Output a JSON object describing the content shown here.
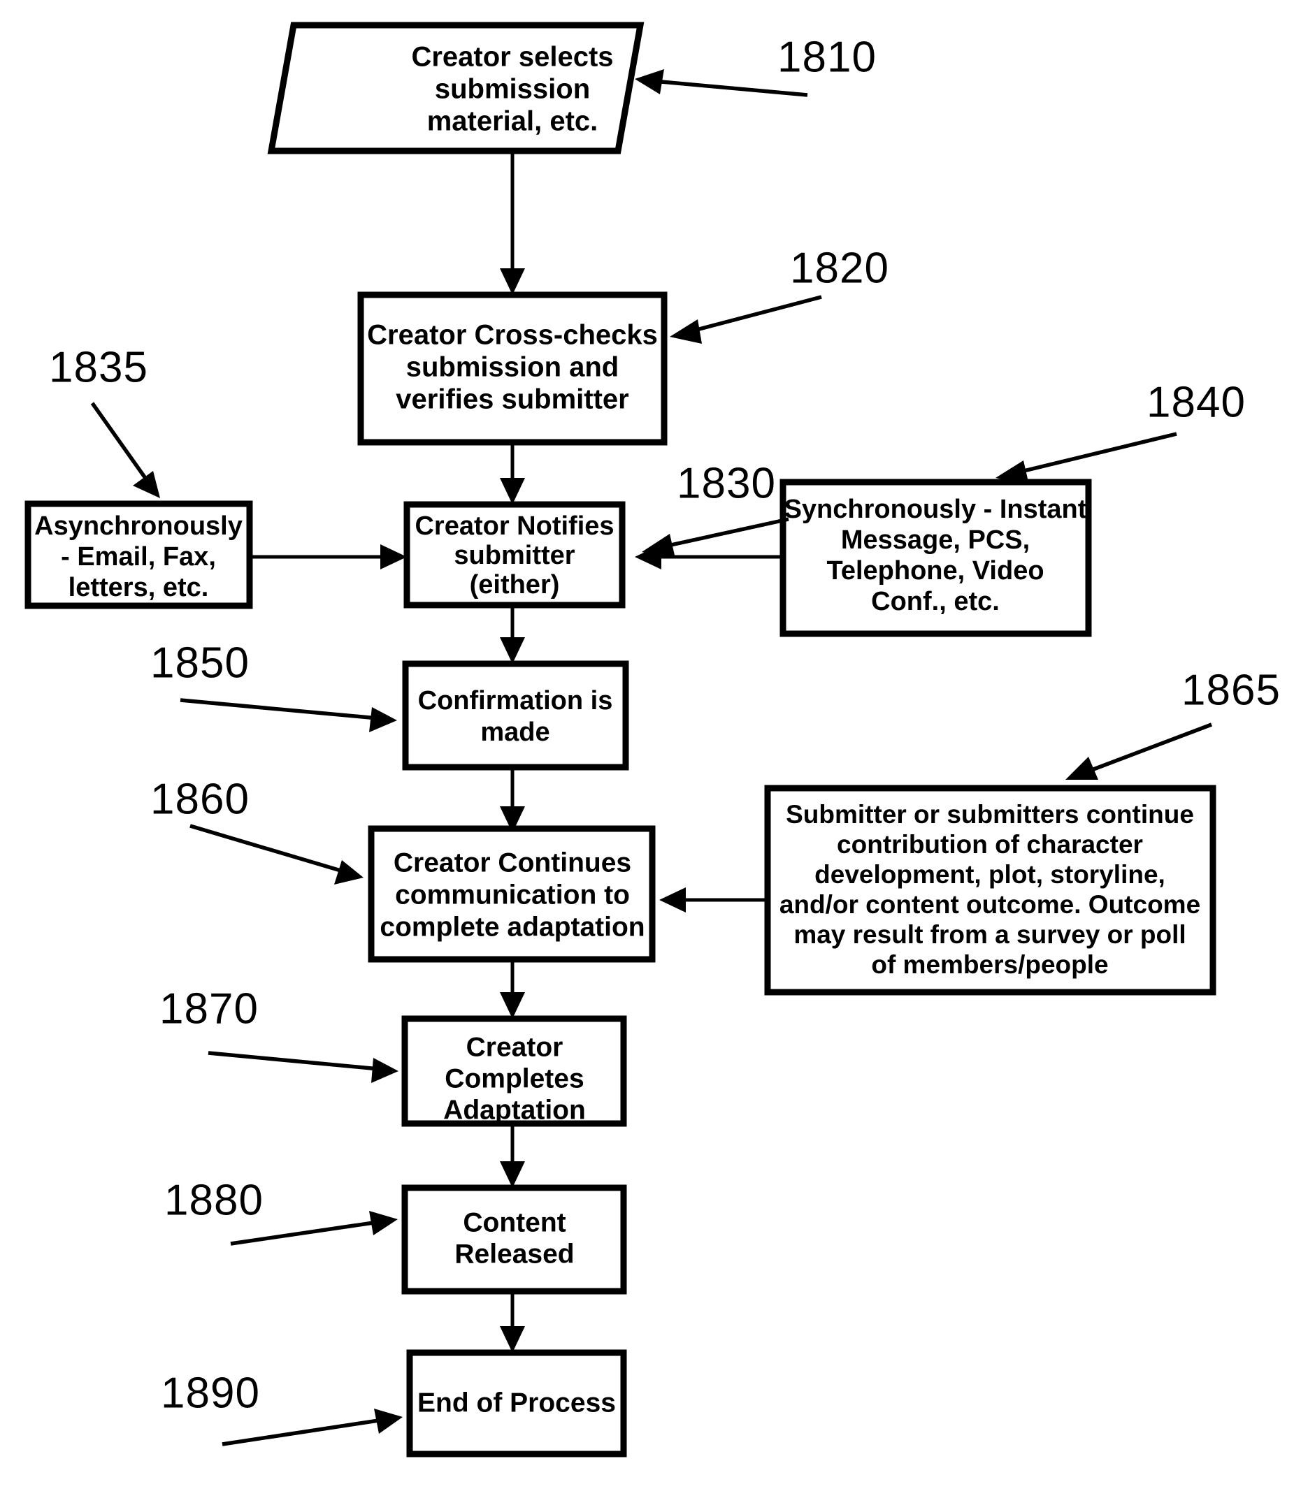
{
  "diagram": {
    "title": "Creator submission and adaptation process flowchart",
    "figure_style": "patent-flowchart",
    "colors": {
      "ink": "#000000",
      "paper": "#ffffff"
    },
    "nodes": [
      {
        "id": "n1810",
        "shape": "parallelogram",
        "ref": "1810",
        "lines": [
          "Creator selects",
          "submission",
          "material, etc."
        ]
      },
      {
        "id": "n1820",
        "shape": "rectangle",
        "ref": "1820",
        "lines": [
          "Creator Cross-checks",
          "submission and",
          "verifies submitter"
        ]
      },
      {
        "id": "n1830",
        "shape": "rectangle",
        "ref": "1830",
        "lines": [
          "Creator Notifies",
          "submitter",
          "(either)"
        ]
      },
      {
        "id": "n1835",
        "shape": "rectangle",
        "ref": "1835",
        "lines": [
          "Asynchronously",
          "- Email, Fax,",
          "letters, etc."
        ]
      },
      {
        "id": "n1840",
        "shape": "rectangle",
        "ref": "1840",
        "lines": [
          "Synchronously - Instant",
          "Message, PCS,",
          "Telephone, Video",
          "Conf., etc."
        ]
      },
      {
        "id": "n1850",
        "shape": "rectangle",
        "ref": "1850",
        "lines": [
          "Confirmation is",
          "made"
        ]
      },
      {
        "id": "n1860",
        "shape": "rectangle",
        "ref": "1860",
        "lines": [
          "Creator Continues",
          "communication to",
          "complete adaptation"
        ]
      },
      {
        "id": "n1865",
        "shape": "rectangle",
        "ref": "1865",
        "lines": [
          "Submitter or submitters continue",
          "contribution of character",
          "development, plot, storyline,",
          "and/or content outcome. Outcome",
          "may result from a survey or poll",
          "of members/people"
        ]
      },
      {
        "id": "n1870",
        "shape": "rectangle",
        "ref": "1870",
        "lines": [
          "Creator",
          "Completes",
          "Adaptation"
        ]
      },
      {
        "id": "n1880",
        "shape": "rectangle",
        "ref": "1880",
        "lines": [
          "Content",
          "Released"
        ]
      },
      {
        "id": "n1890",
        "shape": "rectangle",
        "ref": "1890",
        "lines": [
          "End of Process"
        ]
      }
    ],
    "reference_numerals": [
      {
        "id": "ref-1810",
        "label": "1810"
      },
      {
        "id": "ref-1820",
        "label": "1820"
      },
      {
        "id": "ref-1830",
        "label": "1830"
      },
      {
        "id": "ref-1835",
        "label": "1835"
      },
      {
        "id": "ref-1840",
        "label": "1840"
      },
      {
        "id": "ref-1850",
        "label": "1850"
      },
      {
        "id": "ref-1860",
        "label": "1860"
      },
      {
        "id": "ref-1865",
        "label": "1865"
      },
      {
        "id": "ref-1870",
        "label": "1870"
      },
      {
        "id": "ref-1880",
        "label": "1880"
      },
      {
        "id": "ref-1890",
        "label": "1890"
      }
    ],
    "flow_edges": [
      {
        "from": "1810",
        "to": "1820",
        "direction": "down"
      },
      {
        "from": "1820",
        "to": "1830",
        "direction": "down"
      },
      {
        "from": "1835",
        "to": "1830",
        "direction": "right"
      },
      {
        "from": "1840",
        "to": "1830",
        "direction": "left"
      },
      {
        "from": "1830",
        "to": "1850",
        "direction": "down"
      },
      {
        "from": "1850",
        "to": "1860",
        "direction": "down"
      },
      {
        "from": "1865",
        "to": "1860",
        "direction": "left"
      },
      {
        "from": "1860",
        "to": "1870",
        "direction": "down"
      },
      {
        "from": "1870",
        "to": "1880",
        "direction": "down"
      },
      {
        "from": "1880",
        "to": "1890",
        "direction": "down"
      }
    ]
  }
}
